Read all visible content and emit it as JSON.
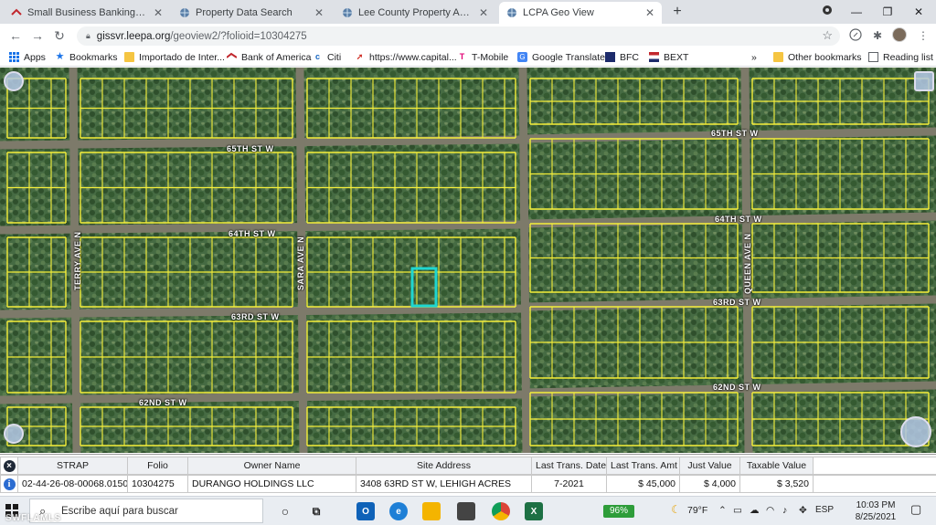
{
  "browser": {
    "tabs": [
      {
        "label": "Small Business Banking, Credit C",
        "favicon": "bank-icon",
        "active": false
      },
      {
        "label": "Property Data Search",
        "favicon": "globe-icon",
        "active": false
      },
      {
        "label": "Lee County Property Appraiser -",
        "favicon": "globe-icon",
        "active": false
      },
      {
        "label": "LCPA Geo View",
        "favicon": "globe-icon",
        "active": true
      }
    ],
    "new_tab": "+",
    "window_controls": [
      "minimize",
      "maximize",
      "close"
    ],
    "url_domain": "gissvr.leepa.org",
    "url_path": "/geoview2/?folioid=10304275"
  },
  "bookmarks": {
    "items": [
      {
        "label": "Apps",
        "icon": "apps-grid-icon"
      },
      {
        "label": "Bookmarks",
        "icon": "star-icon"
      },
      {
        "label": "Importado de Inter...",
        "icon": "folder-icon"
      },
      {
        "label": "Bank of America",
        "icon": "bank-icon"
      },
      {
        "label": "Citi",
        "icon": "citi-icon"
      },
      {
        "label": "https://www.capital...",
        "icon": "capital-one-icon"
      },
      {
        "label": "T-Mobile",
        "icon": "t-mobile-icon"
      },
      {
        "label": "Google Translate",
        "icon": "translate-icon"
      },
      {
        "label": "BFC",
        "icon": "bfc-icon"
      },
      {
        "label": "BEXT",
        "icon": "bext-icon"
      }
    ],
    "overflow": "»",
    "other": "Other bookmarks",
    "reading_list": "Reading list"
  },
  "map": {
    "streets": {
      "st_65_left": "65TH ST W",
      "st_65_right": "65TH ST W",
      "st_64_left": "64TH ST W",
      "st_64_right": "64TH ST W",
      "st_63_left": "63RD ST W",
      "st_63_right": "63RD ST W",
      "st_62_left": "62ND ST W",
      "st_62_right": "62ND ST W",
      "terry": "TERRY AVE N",
      "sara": "SARA AVE N",
      "queen": "QUEEN AVE N"
    },
    "parcel_line_color": "#f5ef3a",
    "highlight_color": "#1fd6d0"
  },
  "results": {
    "headers": [
      "STRAP",
      "Folio",
      "Owner Name",
      "Site Address",
      "Last Trans. Date",
      "Last Trans. Amt",
      "Just Value",
      "Taxable Value"
    ],
    "row": {
      "strap": "02-44-26-08-00068.0150",
      "folio": "10304275",
      "owner": "DURANGO HOLDINGS LLC",
      "address": "3408 63RD ST W, LEHIGH ACRES",
      "date": "7-2021",
      "amount": "$ 45,000",
      "just_value": "$ 4,000",
      "taxable_value": "$ 3,520"
    }
  },
  "taskbar": {
    "search_placeholder": "Escribe aquí para buscar",
    "battery": "96%",
    "weather": "79°F",
    "language": "ESP",
    "time": "10:03 PM",
    "date": "8/25/2021"
  },
  "watermark": "SWFLAMLS"
}
